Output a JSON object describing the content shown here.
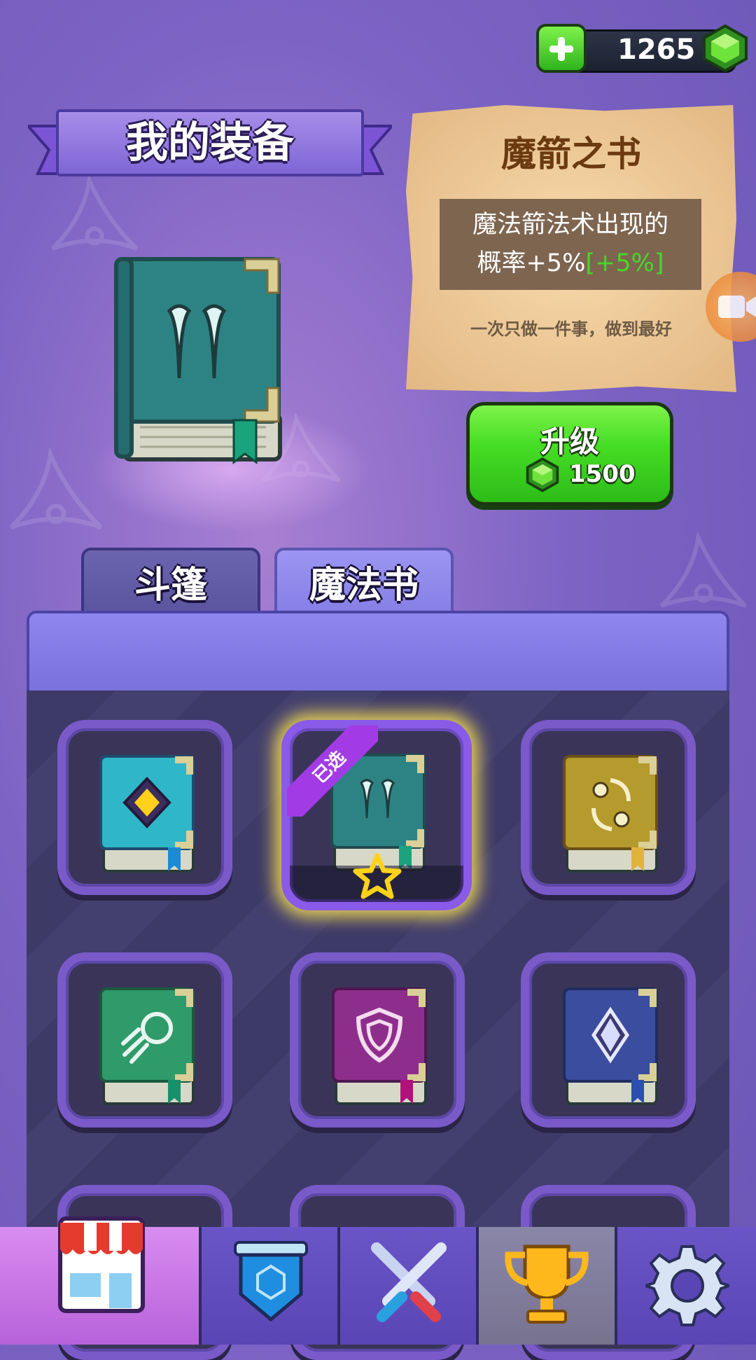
{
  "currency": {
    "amount": "1265",
    "gem_color": "#45d82a"
  },
  "header": {
    "title": "我的装备"
  },
  "item_detail": {
    "name": "魔箭之书",
    "desc_line1": "魔法箭法术出现的",
    "desc_line2": "概率+5%",
    "desc_bonus": "[+5%]",
    "motto": "一次只做一件事，做到最好"
  },
  "upgrade": {
    "label": "升级",
    "cost": "1500"
  },
  "tabs": [
    {
      "label": "斗篷",
      "active": false
    },
    {
      "label": "魔法书",
      "active": true
    }
  ],
  "inventory": {
    "selected_label": "已选",
    "slots": [
      {
        "icon": "diamond-book-icon",
        "color": "#2fb6c8"
      },
      {
        "icon": "magic-arrow-book-icon",
        "color": "#2d8d8d",
        "selected": true
      },
      {
        "icon": "swap-book-icon",
        "color": "#b59a2d"
      },
      {
        "icon": "comet-book-icon",
        "color": "#2f9a6a"
      },
      {
        "icon": "shield-book-icon",
        "color": "#8e2e8c"
      },
      {
        "icon": "crystal-book-icon",
        "color": "#3a4d9e"
      }
    ]
  },
  "nav": [
    {
      "icon": "shop-icon",
      "active": true
    },
    {
      "icon": "banner-icon"
    },
    {
      "icon": "crossed-swords-icon"
    },
    {
      "icon": "trophy-icon"
    },
    {
      "icon": "gear-icon"
    }
  ]
}
